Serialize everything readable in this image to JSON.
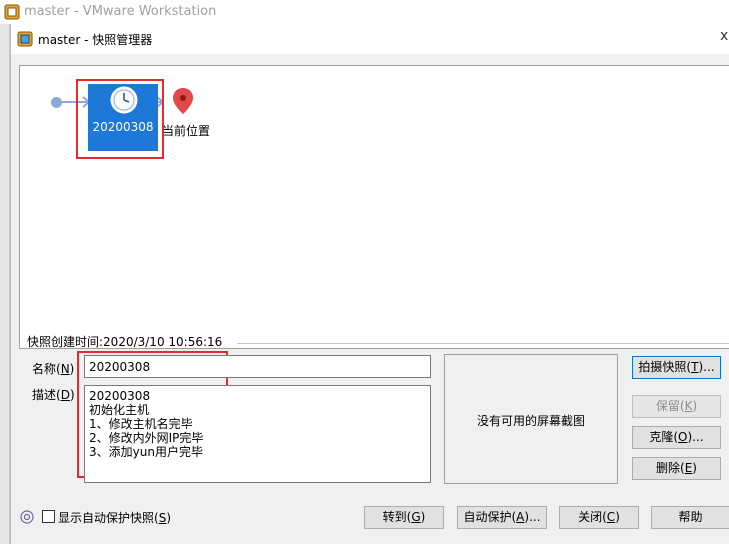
{
  "outer_window": {
    "title": "master - VMware Workstation"
  },
  "dialog": {
    "title": "master - 快照管理器",
    "close_glyph": "x"
  },
  "tree": {
    "snapshot_label": "20200308",
    "current_location_label": "当前位置"
  },
  "details": {
    "created_time": "快照创建时间:2020/3/10 10:56:16",
    "name_label": "名称(",
    "name_key": "N",
    "name_label_end": ")",
    "name_value": "20200308",
    "desc_label": "描述(",
    "desc_key": "D",
    "desc_label_end": ")",
    "desc_lines": [
      "20200308",
      "初始化主机",
      "1、修改主机名完毕",
      "2、修改内外网IP完毕",
      "3、添加yun用户完毕"
    ],
    "no_screenshot": "没有可用的屏幕截图"
  },
  "side_buttons": {
    "take_snapshot": {
      "text": "拍摄快照(",
      "key": "T",
      "end": ")..."
    },
    "keep": {
      "text": "保留(",
      "key": "K",
      "end": ")"
    },
    "clone": {
      "text": "克隆(",
      "key": "O",
      "end": ")..."
    },
    "delete": {
      "text": "删除(",
      "key": "E",
      "end": ")"
    }
  },
  "bottom": {
    "show_autoprotect": {
      "text": "显示自动保护快照(",
      "key": "S",
      "end": ")"
    },
    "goto": {
      "text": "转到(",
      "key": "G",
      "end": ")"
    },
    "autoprotect": {
      "text": "自动保护(",
      "key": "A",
      "end": ")..."
    },
    "close": {
      "text": "关闭(",
      "key": "C",
      "end": ")"
    },
    "help": {
      "text": "帮助"
    }
  },
  "colors": {
    "selection": "#1e78d7",
    "highlight_box": "#e52b2b",
    "tree_line": "#8aa8d8",
    "pin": "#e0484a"
  },
  "icons": [
    "vmware-app-icon",
    "clock-snapshot-icon",
    "location-pin-icon",
    "help-circle-icon",
    "close-icon"
  ]
}
